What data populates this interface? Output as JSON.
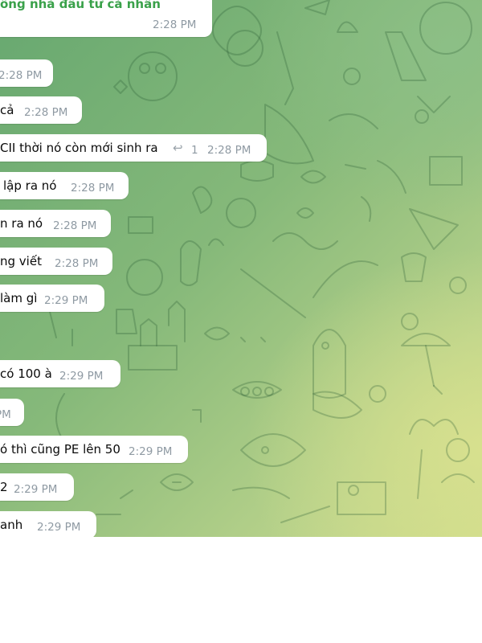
{
  "messages": [
    {
      "text": "ông nhà đầu tư cá nhân",
      "time": "2:28 PM"
    },
    {
      "text": "",
      "time": "2:28 PM"
    },
    {
      "text": "cả",
      "time": "2:28 PM"
    },
    {
      "text": "CII thời nó còn mới sinh ra",
      "time": "2:28 PM",
      "reply_count": "1",
      "reply_icon": "reply-arrow-icon"
    },
    {
      "text": "lập ra nó",
      "time": "2:28 PM"
    },
    {
      "text": "n ra nó",
      "time": "2:28 PM"
    },
    {
      "text": "ng viết",
      "time": "2:28 PM"
    },
    {
      "text": "làm gì",
      "time": "2:29 PM"
    },
    {
      "text": "có 100 à",
      "time": "2:29 PM"
    },
    {
      "text": "",
      "time": "PM"
    },
    {
      "text": "ó thì cũng PE lên 50",
      "time": "2:29 PM"
    },
    {
      "text": "2",
      "time": "2:29 PM"
    },
    {
      "text": "anh",
      "time": "2:29 PM"
    }
  ],
  "colors": {
    "sender_name": "#3aa14a",
    "time_text": "#8f9aa3",
    "bubble_bg": "#ffffff",
    "chat_bg_start": "#67a870",
    "chat_bg_end": "#cfdc8c"
  }
}
